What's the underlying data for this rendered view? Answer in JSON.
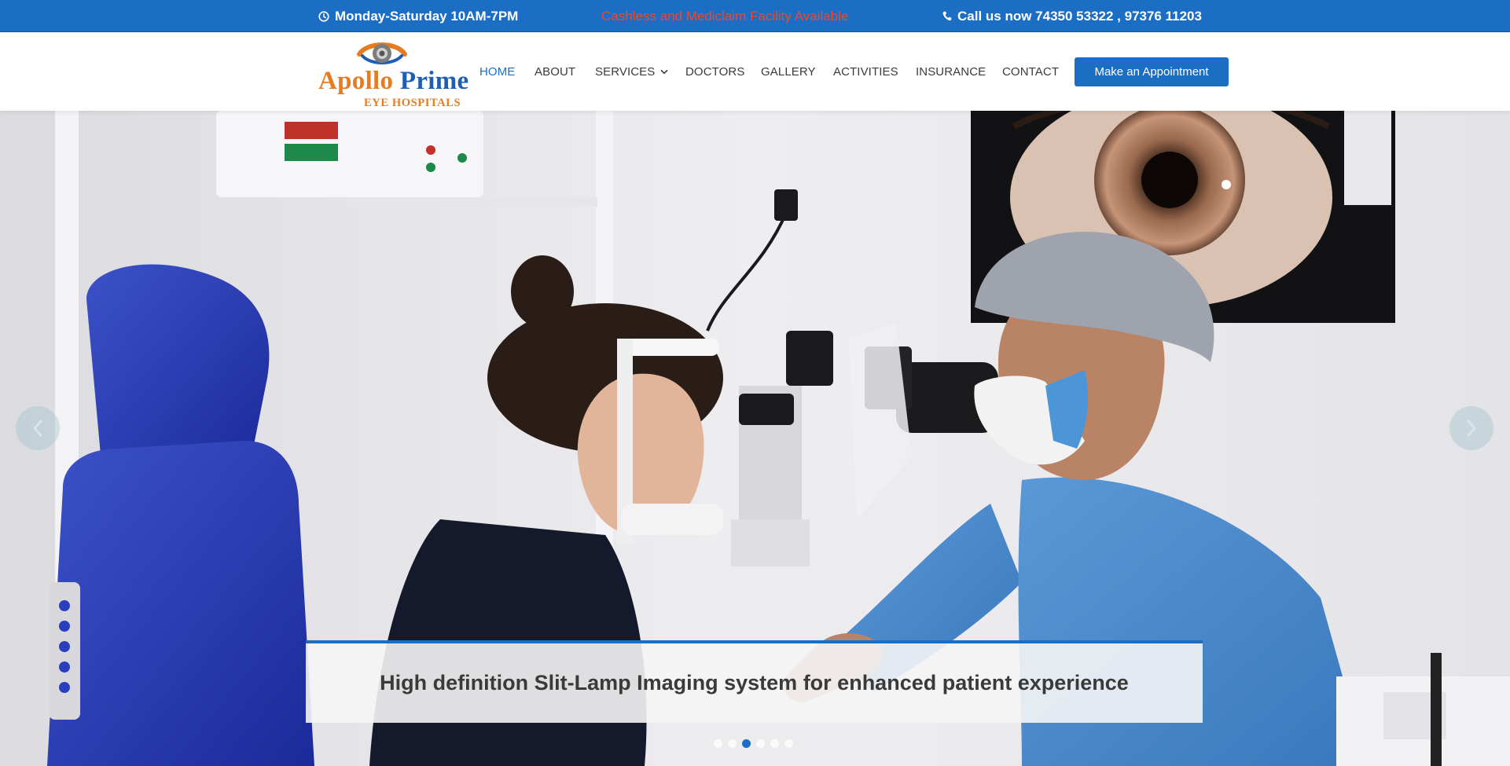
{
  "topbar": {
    "hours": "Monday-Saturday 10AM-7PM",
    "promo": "Cashless and Mediclaim Facility Available",
    "phone": "Call us now 74350 53322 , 97376 11203",
    "bg_color": "#1b6ec3",
    "promo_color": "#e84a2f",
    "icons": {
      "hours": "clock-icon",
      "phone": "phone-icon"
    }
  },
  "header": {
    "logo": {
      "brand_part1": "Apollo",
      "brand_part2": " Prime",
      "subtitle": "EYE HOSPITALS"
    },
    "nav": [
      {
        "label": "HOME",
        "active": true
      },
      {
        "label": "ABOUT"
      },
      {
        "label": "SERVICES",
        "has_dropdown": true
      },
      {
        "label": "DOCTORS"
      },
      {
        "label": "GALLERY"
      },
      {
        "label": "ACTIVITIES"
      },
      {
        "label": "INSURANCE"
      },
      {
        "label": "CONTACT"
      }
    ],
    "cta": "Make an Appointment",
    "accent_color": "#1b6ec3"
  },
  "hero": {
    "caption": "High definition Slit-Lamp Imaging system for enhanced patient experience",
    "slide_count": 6,
    "active_slide": 3,
    "prev_icon": "chevron-left-icon",
    "next_icon": "chevron-right-icon"
  }
}
